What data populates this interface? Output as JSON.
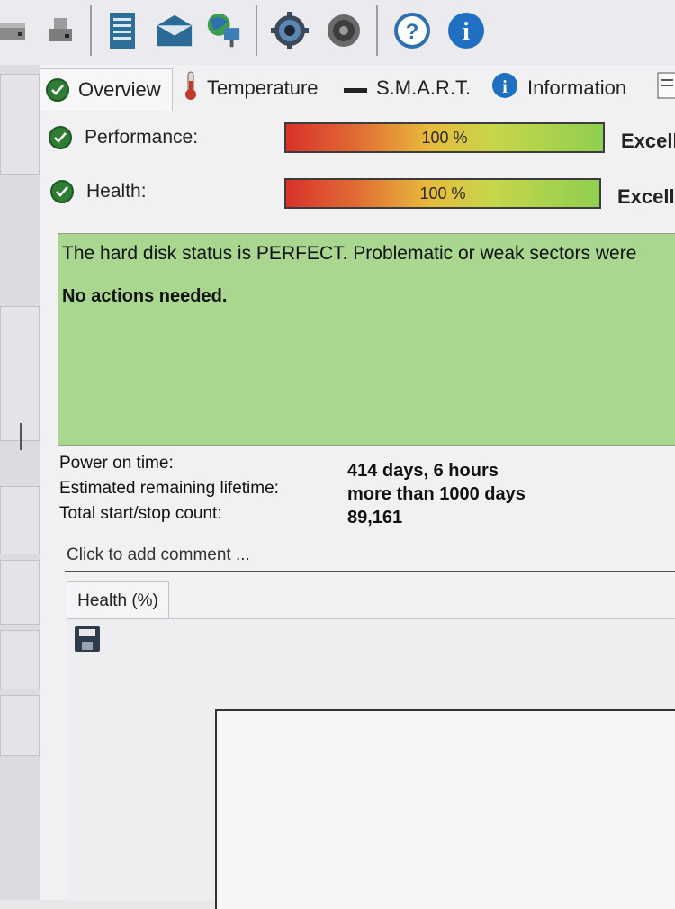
{
  "toolbar": {
    "icons": [
      "drive-icon",
      "drive-small-icon",
      "notepad-icon",
      "mail-icon",
      "network-globe-icon",
      "settings-gear-icon",
      "speaker-icon",
      "help-icon",
      "info-icon"
    ]
  },
  "tabs": [
    {
      "label": "Overview",
      "icon": "check-icon"
    },
    {
      "label": "Temperature",
      "icon": "thermometer-icon"
    },
    {
      "label": "S.M.A.R.T.",
      "icon": "dash-icon"
    },
    {
      "label": "Information",
      "icon": "info-icon"
    }
  ],
  "performance": {
    "label": "Performance:",
    "value": "100 %",
    "percent": 100,
    "rating": "Excell"
  },
  "health": {
    "label": "Health:",
    "value": "100 %",
    "percent": 100,
    "rating": "Excell"
  },
  "status": {
    "line1": "The hard disk status is PERFECT. Problematic or weak sectors were",
    "line2": "No actions needed.",
    "color": "#a9d790"
  },
  "stats": [
    {
      "label": "Power on time:",
      "value": "414 days, 6 hours"
    },
    {
      "label": "Estimated remaining lifetime:",
      "value": "more than 1000 days"
    },
    {
      "label": "Total start/stop count:",
      "value": "89,161"
    }
  ],
  "comment_placeholder": "Click to add comment ...",
  "health_tab": "Health (%)"
}
